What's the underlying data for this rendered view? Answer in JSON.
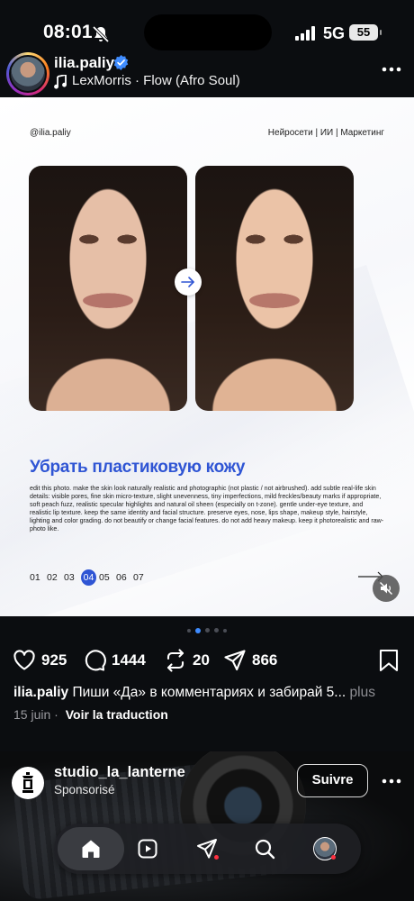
{
  "status_bar": {
    "time": "08:01",
    "network": "5G",
    "battery": "55"
  },
  "post": {
    "username": "ilia.paliy",
    "audio": "LexMorris · Flow (Afro Soul)"
  },
  "slide": {
    "handle": "@ilia.paliy",
    "topics": "Нейросети | ИИ | Маркетинг",
    "title": "Убрать пластиковую кожу",
    "prompt": "edit this photo. make the skin look naturally realistic and photographic (not plastic / not airbrushed). add subtle real-life skin details: visible pores, fine skin micro-texture, slight unevenness, tiny imperfections, mild freckles/beauty marks if appropriate, soft peach fuzz, realistic specular highlights and natural oil sheen (especially on t-zone). gentle under-eye texture, and realistic lip texture. keep the same identity and facial structure. preserve eyes, nose, lips shape, makeup style, hairstyle, lighting and color grading. do not beautify or change facial features. do not add heavy makeup. keep it photorealistic and raw-photo like.",
    "pages": [
      "01",
      "02",
      "03",
      "04",
      "05",
      "06",
      "07"
    ],
    "active_page": "04"
  },
  "carousel": {
    "total_dots": 5,
    "active_index": 1
  },
  "actions": {
    "likes": "925",
    "comments": "1444",
    "reposts": "20",
    "shares": "866"
  },
  "caption": {
    "user": "ilia.paliy",
    "text": "Пиши «Да» в комментариях и забирай 5...",
    "more": "plus"
  },
  "meta": {
    "date": "15 juin",
    "separator": "·",
    "translate": "Voir la traduction"
  },
  "sponsored_post": {
    "name": "studio_la_lanterne",
    "label": "Sponsorisé",
    "follow_label": "Suivre"
  },
  "icons": {
    "status": [
      "bell-off-icon",
      "signal-icon"
    ],
    "post": [
      "verified-icon",
      "music-icon",
      "more-icon"
    ],
    "slide": [
      "arrow-right-icon",
      "mute-icon"
    ],
    "actions": [
      "heart-icon",
      "comment-icon",
      "repost-icon",
      "send-icon",
      "bookmark-icon"
    ],
    "nav": [
      "home-icon",
      "reels-icon",
      "send-icon",
      "search-icon",
      "profile-avatar"
    ]
  },
  "colors": {
    "accent_blue": "#2f55d4",
    "verified_blue": "#3f8cff",
    "notification_red": "#ff3040",
    "background": "#0b0d10"
  }
}
